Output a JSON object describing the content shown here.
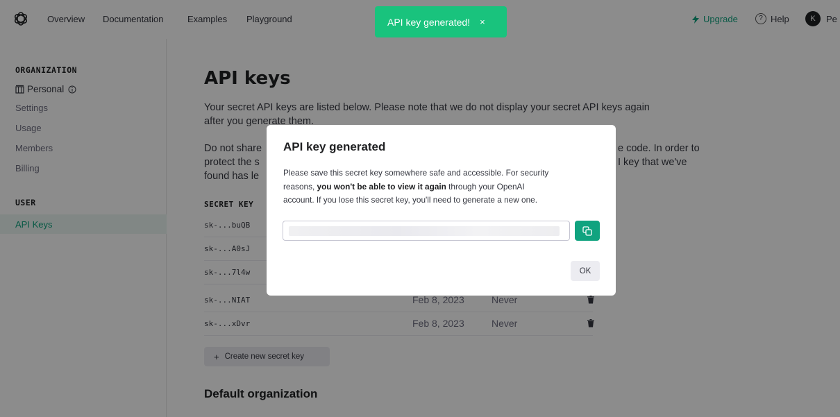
{
  "nav": {
    "links": [
      "Overview",
      "Documentation",
      "Examples",
      "Playground"
    ],
    "upgrade_label": "Upgrade",
    "help_label": "Help",
    "avatar_initial": "K",
    "user_truncated": "Pe"
  },
  "toast": {
    "message": "API key generated!",
    "close": "×"
  },
  "sidebar": {
    "org_heading": "ORGANIZATION",
    "org_name": "Personal",
    "org_items": [
      "Settings",
      "Usage",
      "Members",
      "Billing"
    ],
    "user_heading": "USER",
    "active_item": "API Keys"
  },
  "main": {
    "title": "API keys",
    "para1_line1": "Your secret API keys are listed below. Please note that we do not display your secret API keys again",
    "para1_line2": "after you generate them.",
    "para2_left": [
      "Do not share",
      "protect the s",
      "found has le"
    ],
    "para2_right": [
      "e code. In order to",
      "I key that we've"
    ],
    "table_header": "SECRET KEY",
    "keys": [
      {
        "key": "sk-...buQB",
        "created": "",
        "last_used": ""
      },
      {
        "key": "sk-...A0sJ",
        "created": "",
        "last_used": ""
      },
      {
        "key": "sk-...7l4w",
        "created": "",
        "last_used": ""
      },
      {
        "key": "sk-...NIAT",
        "created": "Feb 8, 2023",
        "last_used": "Never"
      },
      {
        "key": "sk-...xDvr",
        "created": "Feb 8, 2023",
        "last_used": "Never"
      }
    ],
    "create_label": "Create new secret key",
    "default_org_heading": "Default organization"
  },
  "modal": {
    "title": "API key generated",
    "body_line1": "Please save this secret key somewhere safe and accessible. For security",
    "body_prefix": "reasons,",
    "body_bold": "you won't be able to view it again",
    "body_suffix": "through your OpenAI",
    "body_line3": "account. If you lose this secret key, you'll need to generate a new one.",
    "ok_label": "OK"
  },
  "colors": {
    "accent": "#10a37f",
    "toast": "#19c37d"
  }
}
